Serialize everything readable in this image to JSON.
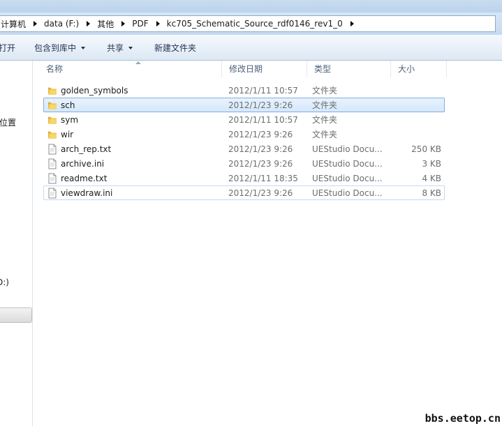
{
  "address": {
    "crumbs": [
      "计算机",
      "data (F:)",
      "其他",
      "PDF",
      "kc705_Schematic_Source_rdf0146_rev1_0"
    ]
  },
  "toolbar": {
    "open_label": "打开",
    "include_library_label": "包含到库中",
    "share_label": "共享",
    "new_folder_label": "新建文件夹"
  },
  "nav": {
    "item_location": "位置",
    "item_drive": "D:)"
  },
  "columns": {
    "name": "名称",
    "date": "修改日期",
    "type": "类型",
    "size": "大小"
  },
  "files": [
    {
      "name": "golden_symbols",
      "date": "2012/1/11 10:57",
      "type": "文件夹",
      "size": "",
      "kind": "folder-icon"
    },
    {
      "name": "sch",
      "date": "2012/1/23 9:26",
      "type": "文件夹",
      "size": "",
      "kind": "folder-icon"
    },
    {
      "name": "sym",
      "date": "2012/1/11 10:57",
      "type": "文件夹",
      "size": "",
      "kind": "folder-icon"
    },
    {
      "name": "wir",
      "date": "2012/1/23 9:26",
      "type": "文件夹",
      "size": "",
      "kind": "folder-icon"
    },
    {
      "name": "arch_rep.txt",
      "date": "2012/1/23 9:26",
      "type": "UEStudio Docu...",
      "size": "250 KB",
      "kind": "file-icon"
    },
    {
      "name": "archive.ini",
      "date": "2012/1/23 9:26",
      "type": "UEStudio Docu...",
      "size": "3 KB",
      "kind": "file-icon"
    },
    {
      "name": "readme.txt",
      "date": "2012/1/11 18:35",
      "type": "UEStudio Docu...",
      "size": "4 KB",
      "kind": "file-icon"
    },
    {
      "name": "viewdraw.ini",
      "date": "2012/1/23 9:26",
      "type": "UEStudio Docu...",
      "size": "8 KB",
      "kind": "file-icon"
    }
  ],
  "selected_row": 1,
  "focused_row": 7,
  "colors": {
    "selection_fill": "#d9e9fc",
    "selection_border": "#84acdd",
    "folder_yellow": "#f3c84a"
  },
  "watermark": "bbs.eetop.cn"
}
